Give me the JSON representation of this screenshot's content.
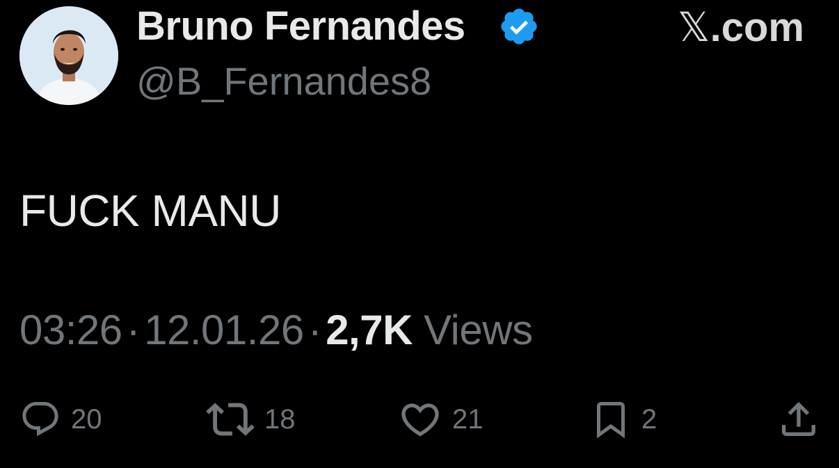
{
  "author": {
    "display_name": "Bruno Fernandes",
    "handle": "@B_Fernandes8",
    "verified": true
  },
  "brand": {
    "x_glyph": "𝕏",
    "domain": ".com"
  },
  "tweet": {
    "text": "FUCK MANU",
    "time": "03:26",
    "separator": "·",
    "date": "12.01.26",
    "views_count": "2,7K",
    "views_label": "Views"
  },
  "actions": {
    "replies": "20",
    "reposts": "18",
    "likes": "21",
    "bookmarks": "2"
  },
  "colors": {
    "background": "#000000",
    "primary_text": "#e7e9ea",
    "secondary_text": "#71767b",
    "verified_badge": "#1d9bf0"
  }
}
